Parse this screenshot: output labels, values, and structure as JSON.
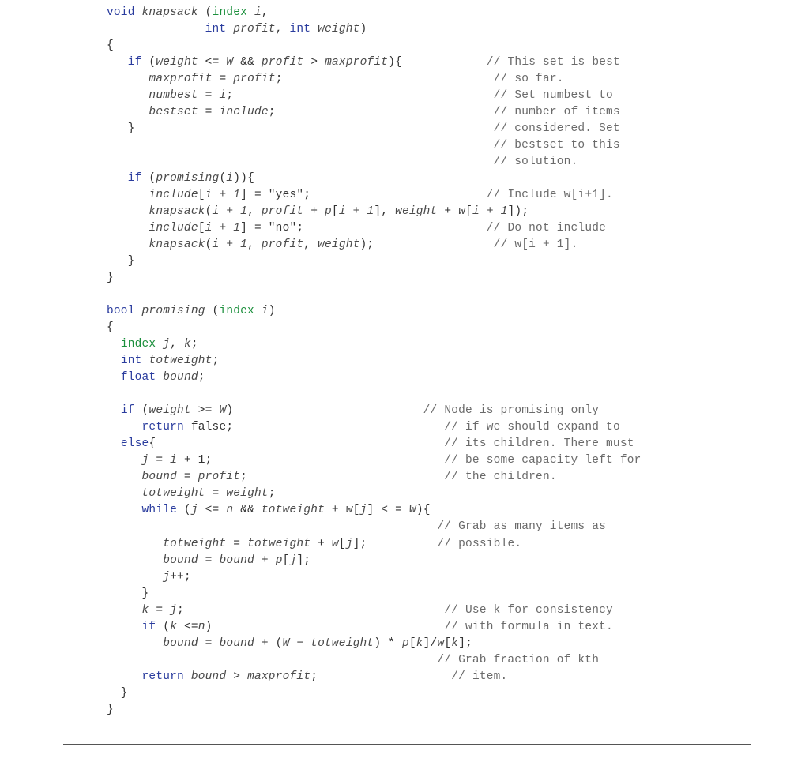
{
  "fn1": {
    "ret": "void",
    "name": "knapsack",
    "argty1": "index",
    "arg1": "i",
    "argty2": "int",
    "arg2": "profit",
    "argty3": "int",
    "arg3": "weight"
  },
  "c": {
    "if1": "if",
    "cond1a": "weight",
    "le": "<=",
    "W": "W",
    "amp": "&&",
    "cond1b": "profit",
    "gt": ">",
    "maxprofit": "maxprofit",
    "assign_mp": "maxprofit",
    "eq": "=",
    "profit": "profit",
    "numbest": "numbest",
    "i": "i",
    "bestset": "bestset",
    "include": "include",
    "cmt1": "// This set is best",
    "cmt2": "// so far.",
    "cmt3": "// Set numbest to",
    "cmt4": "// number of items",
    "cmt5": "// considered. Set",
    "cmt6": "// bestset to this",
    "cmt7": "// solution.",
    "if2": "if",
    "promising": "promising",
    "incl": "include",
    "ip1": "i + 1",
    "yes": "\"yes\"",
    "no": "\"no\"",
    "knap": "knapsack",
    "p": "p",
    "w": "w",
    "weight": "weight",
    "cmt8": "// Include w[i+1].",
    "cmt9": "// Do not include",
    "cmt10": "// w[i + 1]."
  },
  "fn2": {
    "ret": "bool",
    "name": "promising",
    "argty": "index",
    "arg": "i"
  },
  "d": {
    "index": "index",
    "j": "j",
    "k": "k",
    "int": "int",
    "totw": "totweight",
    "float": "float",
    "bound": "bound",
    "if": "if",
    "weight": "weight",
    "ge": ">=",
    "W": "W",
    "return": "return",
    "false": "false",
    "else": "else",
    "i": "i",
    "profit": "profit",
    "while": "while",
    "n": "n",
    "amp": "&&",
    "le": "<=",
    "lee": "< =",
    "cmt1": "// Node is promising only",
    "cmt2": "// if we should expand to",
    "cmt3": "// its children. There must",
    "cmt4": "// be some capacity left for",
    "cmt5": "// the children.",
    "cmt6": "// Grab as many items as",
    "cmt7": "// possible.",
    "cmt8": "// Use k for consistency",
    "cmt9": "// with formula in text.",
    "Wm": "W",
    "p": "p",
    "w": "w",
    "cmt10": "// Grab fraction of kth",
    "cmt11": "// item.",
    "maxprofit": "maxprofit"
  }
}
